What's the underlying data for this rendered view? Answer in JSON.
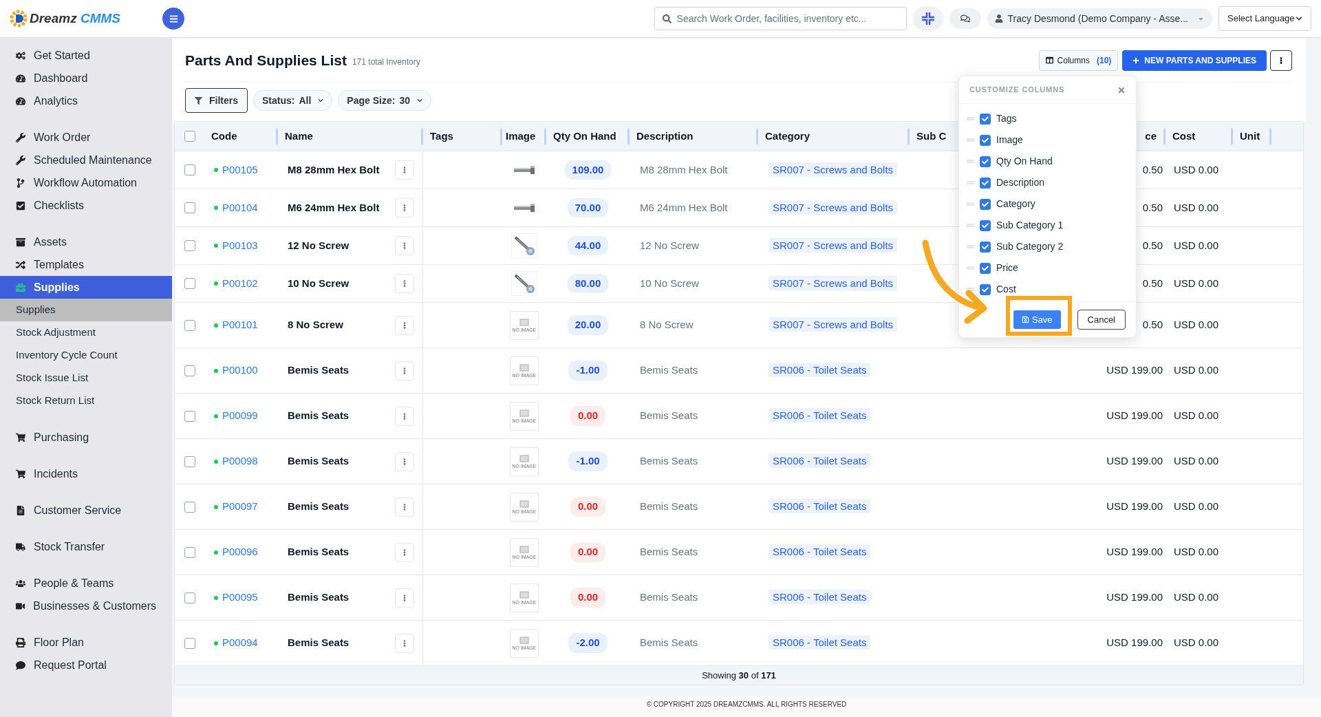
{
  "topbar": {
    "logo": {
      "word": "Dreamz",
      "accent": "CMMS"
    },
    "search": {
      "placeholder": "Search Work Order, facilities, inventory etc..."
    },
    "user": "Tracy Desmond (Demo Company - Asse...",
    "language": "Select Language"
  },
  "sidebar": {
    "groups": [
      {
        "items": [
          {
            "label": "Get Started",
            "selected": false
          },
          {
            "label": "Dashboard",
            "selected": false
          },
          {
            "label": "Analytics",
            "selected": false
          }
        ]
      },
      {
        "items": [
          {
            "label": "Work Order",
            "selected": false
          },
          {
            "label": "Scheduled Maintenance",
            "selected": false
          },
          {
            "label": "Workflow Automation",
            "selected": false
          },
          {
            "label": "Checklists",
            "selected": false
          }
        ]
      },
      {
        "items": [
          {
            "label": "Assets",
            "selected": false
          },
          {
            "label": "Templates",
            "selected": false
          },
          {
            "label": "Supplies",
            "selected": true,
            "children": [
              {
                "label": "Supplies",
                "selected": true
              },
              {
                "label": "Stock Adjustment",
                "selected": false
              },
              {
                "label": "Inventory Cycle Count",
                "selected": false
              },
              {
                "label": "Stock Issue List",
                "selected": false
              },
              {
                "label": "Stock Return List",
                "selected": false
              }
            ]
          }
        ]
      },
      {
        "items": [
          {
            "label": "Purchasing",
            "selected": false
          }
        ]
      },
      {
        "items": [
          {
            "label": "Incidents",
            "selected": false
          }
        ]
      },
      {
        "items": [
          {
            "label": "Customer Service",
            "selected": false
          }
        ]
      },
      {
        "items": [
          {
            "label": "Stock Transfer",
            "selected": false
          }
        ]
      },
      {
        "items": [
          {
            "label": "People & Teams",
            "selected": false
          },
          {
            "label": "Businesses & Customers",
            "selected": false
          }
        ]
      },
      {
        "items": [
          {
            "label": "Floor Plan",
            "selected": false
          },
          {
            "label": "Request Portal",
            "selected": false
          }
        ]
      }
    ]
  },
  "page": {
    "title": "Parts And Supplies List",
    "subtitle": "171 total Inventory",
    "columns_button": {
      "label": "Columns",
      "count": "(10)"
    },
    "new_button": "NEW PARTS AND SUPPLIES"
  },
  "filters": {
    "button": "Filters",
    "selects": [
      {
        "label": "Status:",
        "value": "All"
      },
      {
        "label": "Page Size:",
        "value": "30"
      }
    ]
  },
  "table": {
    "select_all": false,
    "columns": [
      "Code",
      "Name",
      "Tags",
      "Image",
      "Qty On Hand",
      "Description",
      "Category",
      "Sub C",
      "ce",
      "Cost",
      "Unit"
    ],
    "rows": [
      {
        "selected": false,
        "active": true,
        "code": "P00105",
        "name": "M8 28mm Hex Bolt",
        "image": {
          "kind": "bolt"
        },
        "qty": "109.00",
        "out_of_stock": false,
        "description": "M8 28mm Hex Bolt",
        "category": "SR007 - Screws and Bolts",
        "price": "0.50",
        "cost": "USD 0.00"
      },
      {
        "selected": false,
        "active": true,
        "code": "P00104",
        "name": "M6 24mm Hex Bolt",
        "image": {
          "kind": "bolt"
        },
        "qty": "70.00",
        "out_of_stock": false,
        "description": "M6 24mm Hex Bolt",
        "category": "SR007 - Screws and Bolts",
        "price": "0.50",
        "cost": "USD 0.00"
      },
      {
        "selected": false,
        "active": true,
        "code": "P00103",
        "name": "12 No Screw",
        "image": {
          "kind": "screw"
        },
        "qty": "44.00",
        "out_of_stock": false,
        "description": "12 No Screw",
        "category": "SR007 - Screws and Bolts",
        "price": "0.50",
        "cost": "USD 0.00"
      },
      {
        "selected": false,
        "active": true,
        "code": "P00102",
        "name": "10 No Screw",
        "image": {
          "kind": "screw"
        },
        "qty": "80.00",
        "out_of_stock": false,
        "description": "10 No Screw",
        "category": "SR007 - Screws and Bolts",
        "price": "0.50",
        "cost": "USD 0.00"
      },
      {
        "selected": false,
        "active": true,
        "code": "P00101",
        "name": "8 No Screw",
        "image": {
          "kind": "placeholder",
          "label": "NO IMAGE"
        },
        "qty": "20.00",
        "out_of_stock": false,
        "description": "8 No Screw",
        "category": "SR007 - Screws and Bolts",
        "price": "0.50",
        "cost": "USD 0.00"
      },
      {
        "selected": false,
        "active": true,
        "code": "P00100",
        "name": "Bemis Seats",
        "image": {
          "kind": "placeholder",
          "label": "NO IMAGE"
        },
        "qty": "-1.00",
        "out_of_stock": false,
        "description": "Bemis Seats",
        "category": "SR006 - Toilet Seats",
        "price": "USD 199.00",
        "cost": "USD 0.00"
      },
      {
        "selected": false,
        "active": true,
        "code": "P00099",
        "name": "Bemis Seats",
        "image": {
          "kind": "placeholder",
          "label": "NO IMAGE"
        },
        "qty": "0.00",
        "out_of_stock": true,
        "description": "Bemis Seats",
        "category": "SR006 - Toilet Seats",
        "price": "USD 199.00",
        "cost": "USD 0.00"
      },
      {
        "selected": false,
        "active": true,
        "code": "P00098",
        "name": "Bemis Seats",
        "image": {
          "kind": "placeholder",
          "label": "NO IMAGE"
        },
        "qty": "-1.00",
        "out_of_stock": false,
        "description": "Bemis Seats",
        "category": "SR006 - Toilet Seats",
        "price": "USD 199.00",
        "cost": "USD 0.00"
      },
      {
        "selected": false,
        "active": true,
        "code": "P00097",
        "name": "Bemis Seats",
        "image": {
          "kind": "placeholder",
          "label": "NO IMAGE"
        },
        "qty": "0.00",
        "out_of_stock": true,
        "description": "Bemis Seats",
        "category": "SR006 - Toilet Seats",
        "price": "USD 199.00",
        "cost": "USD 0.00"
      },
      {
        "selected": false,
        "active": true,
        "code": "P00096",
        "name": "Bemis Seats",
        "image": {
          "kind": "placeholder",
          "label": "NO IMAGE"
        },
        "qty": "0.00",
        "out_of_stock": true,
        "description": "Bemis Seats",
        "category": "SR006 - Toilet Seats",
        "price": "USD 199.00",
        "cost": "USD 0.00"
      },
      {
        "selected": false,
        "active": true,
        "code": "P00095",
        "name": "Bemis Seats",
        "image": {
          "kind": "placeholder",
          "label": "NO IMAGE"
        },
        "qty": "0.00",
        "out_of_stock": true,
        "description": "Bemis Seats",
        "category": "SR006 - Toilet Seats",
        "price": "USD 199.00",
        "cost": "USD 0.00"
      },
      {
        "selected": false,
        "active": true,
        "code": "P00094",
        "name": "Bemis Seats",
        "image": {
          "kind": "placeholder",
          "label": "NO IMAGE"
        },
        "qty": "-2.00",
        "out_of_stock": false,
        "description": "Bemis Seats",
        "category": "SR006 - Toilet Seats",
        "price": "USD 199.00",
        "cost": "USD 0.00"
      }
    ],
    "footer": "Showing **30** of **171**"
  },
  "customize_columns": {
    "title": "CUSTOMIZE COLUMNS",
    "items": [
      {
        "label": "Tags",
        "checked": true
      },
      {
        "label": "Image",
        "checked": true
      },
      {
        "label": "Qty On Hand",
        "checked": true
      },
      {
        "label": "Description",
        "checked": true
      },
      {
        "label": "Category",
        "checked": true
      },
      {
        "label": "Sub Category 1",
        "checked": true
      },
      {
        "label": "Sub Category 2",
        "checked": true
      },
      {
        "label": "Price",
        "checked": true
      },
      {
        "label": "Cost",
        "checked": true
      }
    ],
    "save": "Save",
    "cancel": "Cancel"
  },
  "copyright": "© COPYRIGHT 2025 DREAMZCMMS. ALL RIGHTS RESERVED"
}
